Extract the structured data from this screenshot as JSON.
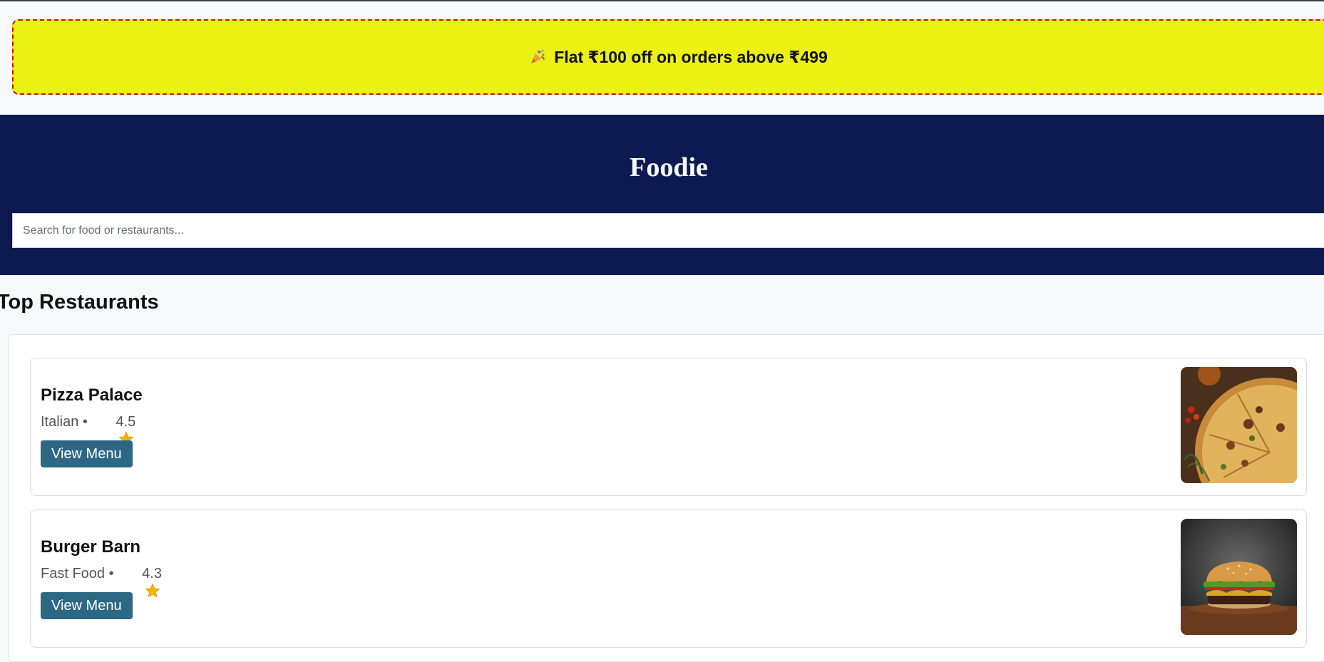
{
  "promo": {
    "icon": "party-popper-icon",
    "text": "Flat ₹100 off on orders above ₹499",
    "background": "#ebf113",
    "border_color": "#c0132b"
  },
  "header": {
    "brand": "Foodie",
    "background": "#0d1a52"
  },
  "search": {
    "placeholder": "Search for food or restaurants...",
    "value": ""
  },
  "section": {
    "title": "Top Restaurants"
  },
  "restaurants": [
    {
      "name": "Pizza Palace",
      "cuisine": "Italian • ",
      "rating_icon": "star-icon",
      "rating": "4.5",
      "button_label": "View Menu",
      "image": "pizza-photo"
    },
    {
      "name": "Burger Barn",
      "cuisine": "Fast Food • ",
      "rating_icon": "star-icon",
      "rating": "4.3",
      "button_label": "View Menu",
      "image": "burger-photo"
    }
  ],
  "colors": {
    "button": "#2d6786",
    "page_bg": "#f8f9fb"
  }
}
